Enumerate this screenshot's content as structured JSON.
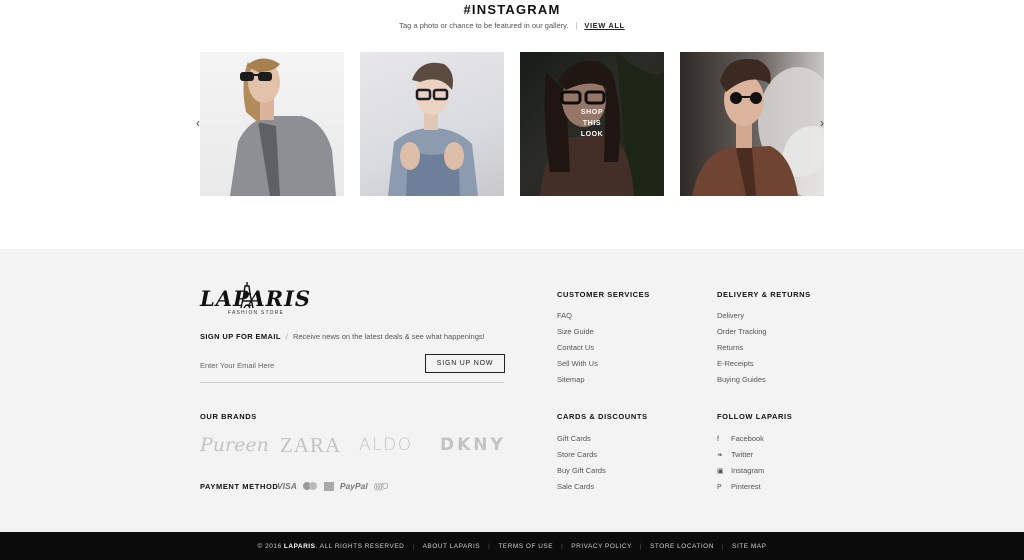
{
  "instagram": {
    "title": "#INSTAGRAM",
    "subtitle": "Tag a photo or chance to be featured in our gallery.",
    "view_all": "VIEW ALL",
    "overlay": [
      "SHOP",
      "THIS",
      "LOOK"
    ],
    "prev_icon": "chevron-left-icon",
    "next_icon": "chevron-right-icon"
  },
  "footer": {
    "logo": {
      "name": "LAPARIS",
      "tagline": "FASHION STORE",
      "icon": "eiffel-tower-icon"
    },
    "signup": {
      "title": "SIGN UP FOR EMAIL",
      "text": "Receive news on the latest deals & see what happenings!",
      "placeholder": "Enter Your Email Here",
      "button": "SIGN UP NOW"
    },
    "brands": {
      "title": "OUR BRANDS",
      "items": [
        "Pureen",
        "ZARA",
        "ALDO",
        "DKNY"
      ]
    },
    "payment": {
      "title": "PAYMENT METHOD",
      "items": [
        "VISA",
        "PayPal",
        "(((((O"
      ]
    },
    "customer_services": {
      "title": "CUSTOMER SERVICES",
      "items": [
        "FAQ",
        "Size Guide",
        "Contact Us",
        "Sell With Us",
        "Sitemap"
      ]
    },
    "delivery_returns": {
      "title": "DELIVERY & RETURNS",
      "items": [
        "Delivery",
        "Order Tracking",
        "Returns",
        "E-Receipts",
        "Buying Guides"
      ]
    },
    "cards_discounts": {
      "title": "CARDS & DISCOUNTS",
      "items": [
        "Gift Cards",
        "Store Cards",
        "Buy Gift Cards",
        "Sale Cards"
      ]
    },
    "follow": {
      "title": "FOLLOW LAPARIS",
      "items": [
        {
          "icon": "facebook-icon",
          "glyph": "f",
          "label": "Facebook"
        },
        {
          "icon": "twitter-icon",
          "glyph": "❧",
          "label": "Twitter"
        },
        {
          "icon": "instagram-icon",
          "glyph": "▣",
          "label": "Instagram"
        },
        {
          "icon": "pinterest-icon",
          "glyph": "P",
          "label": "Pinterest"
        }
      ]
    }
  },
  "bottom_bar": {
    "copyright_prefix": "© 2016",
    "brand": "LAPARIS",
    "copyright_suffix": ". ALL RIGHTS RESERVED",
    "links": [
      "ABOUT LAPARIS",
      "TERMS OF USE",
      "PRIVACY POLICY",
      "STORE LOCATION",
      "SITE MAP"
    ]
  }
}
